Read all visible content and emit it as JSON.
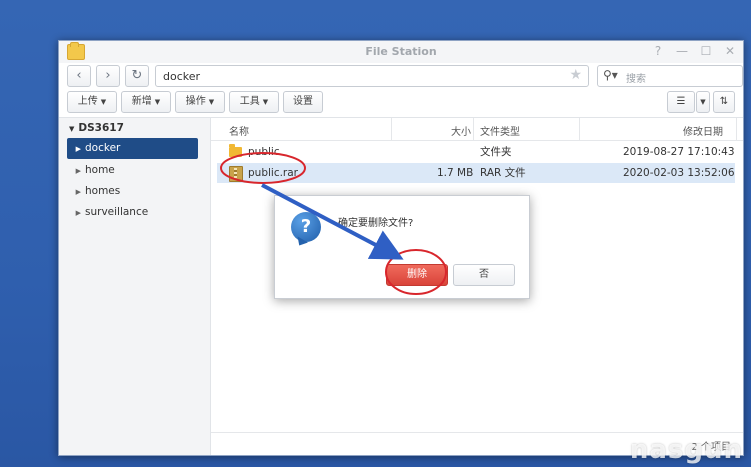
{
  "window": {
    "title": "File Station"
  },
  "nav": {
    "path": "docker",
    "search_placeholder": "搜索"
  },
  "toolbar": {
    "upload": "上传",
    "create": "新增",
    "action": "操作",
    "tools": "工具",
    "settings": "设置"
  },
  "sidebar": {
    "root": "DS3617",
    "items": [
      {
        "label": "docker",
        "selected": true
      },
      {
        "label": "home"
      },
      {
        "label": "homes"
      },
      {
        "label": "surveillance"
      }
    ]
  },
  "files": {
    "columns": {
      "name": "名称",
      "size": "大小",
      "type": "文件类型",
      "modified": "修改日期"
    },
    "rows": [
      {
        "name": "public",
        "size": "",
        "type": "文件夹",
        "modified": "2019-08-27 17:10:43",
        "icon": "folder-icon"
      },
      {
        "name": "public.rar",
        "size": "1.7 MB",
        "type": "RAR 文件",
        "modified": "2020-02-03 13:52:06",
        "icon": "rar-file-icon",
        "selected": true
      }
    ],
    "status": "2 个项目"
  },
  "dialog": {
    "message": "确定要删除文件?",
    "delete_label": "删除",
    "no_label": "否"
  },
  "watermark": {
    "text": "nasgun"
  },
  "colors": {
    "selection": "#1f4c87",
    "danger": "#d9443a",
    "annotation": "#d8262c",
    "arrow": "#2f5fc4"
  }
}
